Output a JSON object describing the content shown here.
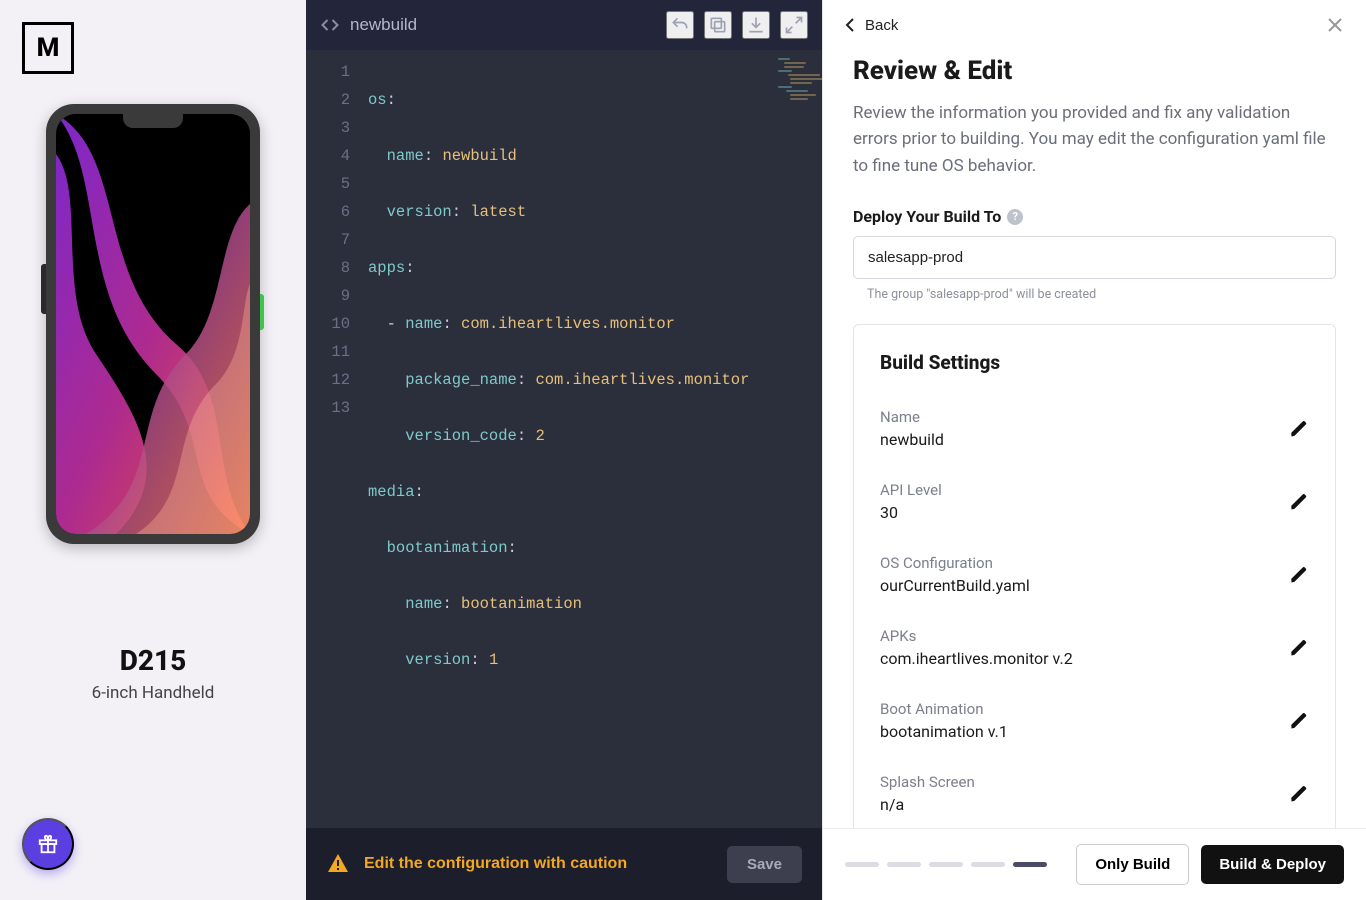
{
  "logo_letter": "M",
  "device": {
    "name": "D215",
    "subtitle": "6-inch Handheld"
  },
  "editor": {
    "filename": "newbuild",
    "lines": [
      "1",
      "2",
      "3",
      "4",
      "5",
      "6",
      "7",
      "8",
      "9",
      "10",
      "11",
      "12",
      "13"
    ],
    "code": {
      "l1_key": "os",
      "l1_p": ":",
      "l2_key": "name",
      "l2_p": ": ",
      "l2_v": "newbuild",
      "l3_key": "version",
      "l3_p": ": ",
      "l3_v": "latest",
      "l4_key": "apps",
      "l4_p": ":",
      "l5_dash": "- ",
      "l5_key": "name",
      "l5_p": ": ",
      "l5_v": "com.iheartlives.monitor",
      "l6_key": "package_name",
      "l6_p": ": ",
      "l6_v": "com.iheartlives.monitor",
      "l7_key": "version_code",
      "l7_p": ": ",
      "l7_v": "2",
      "l8_key": "media",
      "l8_p": ":",
      "l9_key": "bootanimation",
      "l9_p": ":",
      "l10_key": "name",
      "l10_p": ": ",
      "l10_v": "bootanimation",
      "l11_key": "version",
      "l11_p": ": ",
      "l11_v": "1"
    },
    "footer_warning": "Edit the configuration with caution",
    "save_label": "Save"
  },
  "review": {
    "back_label": "Back",
    "title": "Review & Edit",
    "description": "Review the information you provided and fix any validation errors prior to building. You may edit the configuration yaml file to fine tune OS behavior.",
    "deploy_label": "Deploy Your Build To",
    "deploy_value": "salesapp-prod",
    "deploy_hint": "The group \"salesapp-prod\" will be created",
    "settings_title": "Build Settings",
    "settings": [
      {
        "label": "Name",
        "value": "newbuild"
      },
      {
        "label": "API Level",
        "value": "30"
      },
      {
        "label": "OS Configuration",
        "value": "ourCurrentBuild.yaml"
      },
      {
        "label": "APKs",
        "value": "com.iheartlives.monitor v.2"
      },
      {
        "label": "Boot Animation",
        "value": "bootanimation v.1"
      },
      {
        "label": "Splash Screen",
        "value": "n/a"
      }
    ],
    "only_build_label": "Only Build",
    "build_deploy_label": "Build & Deploy",
    "step_count": 5,
    "active_step": 5
  }
}
